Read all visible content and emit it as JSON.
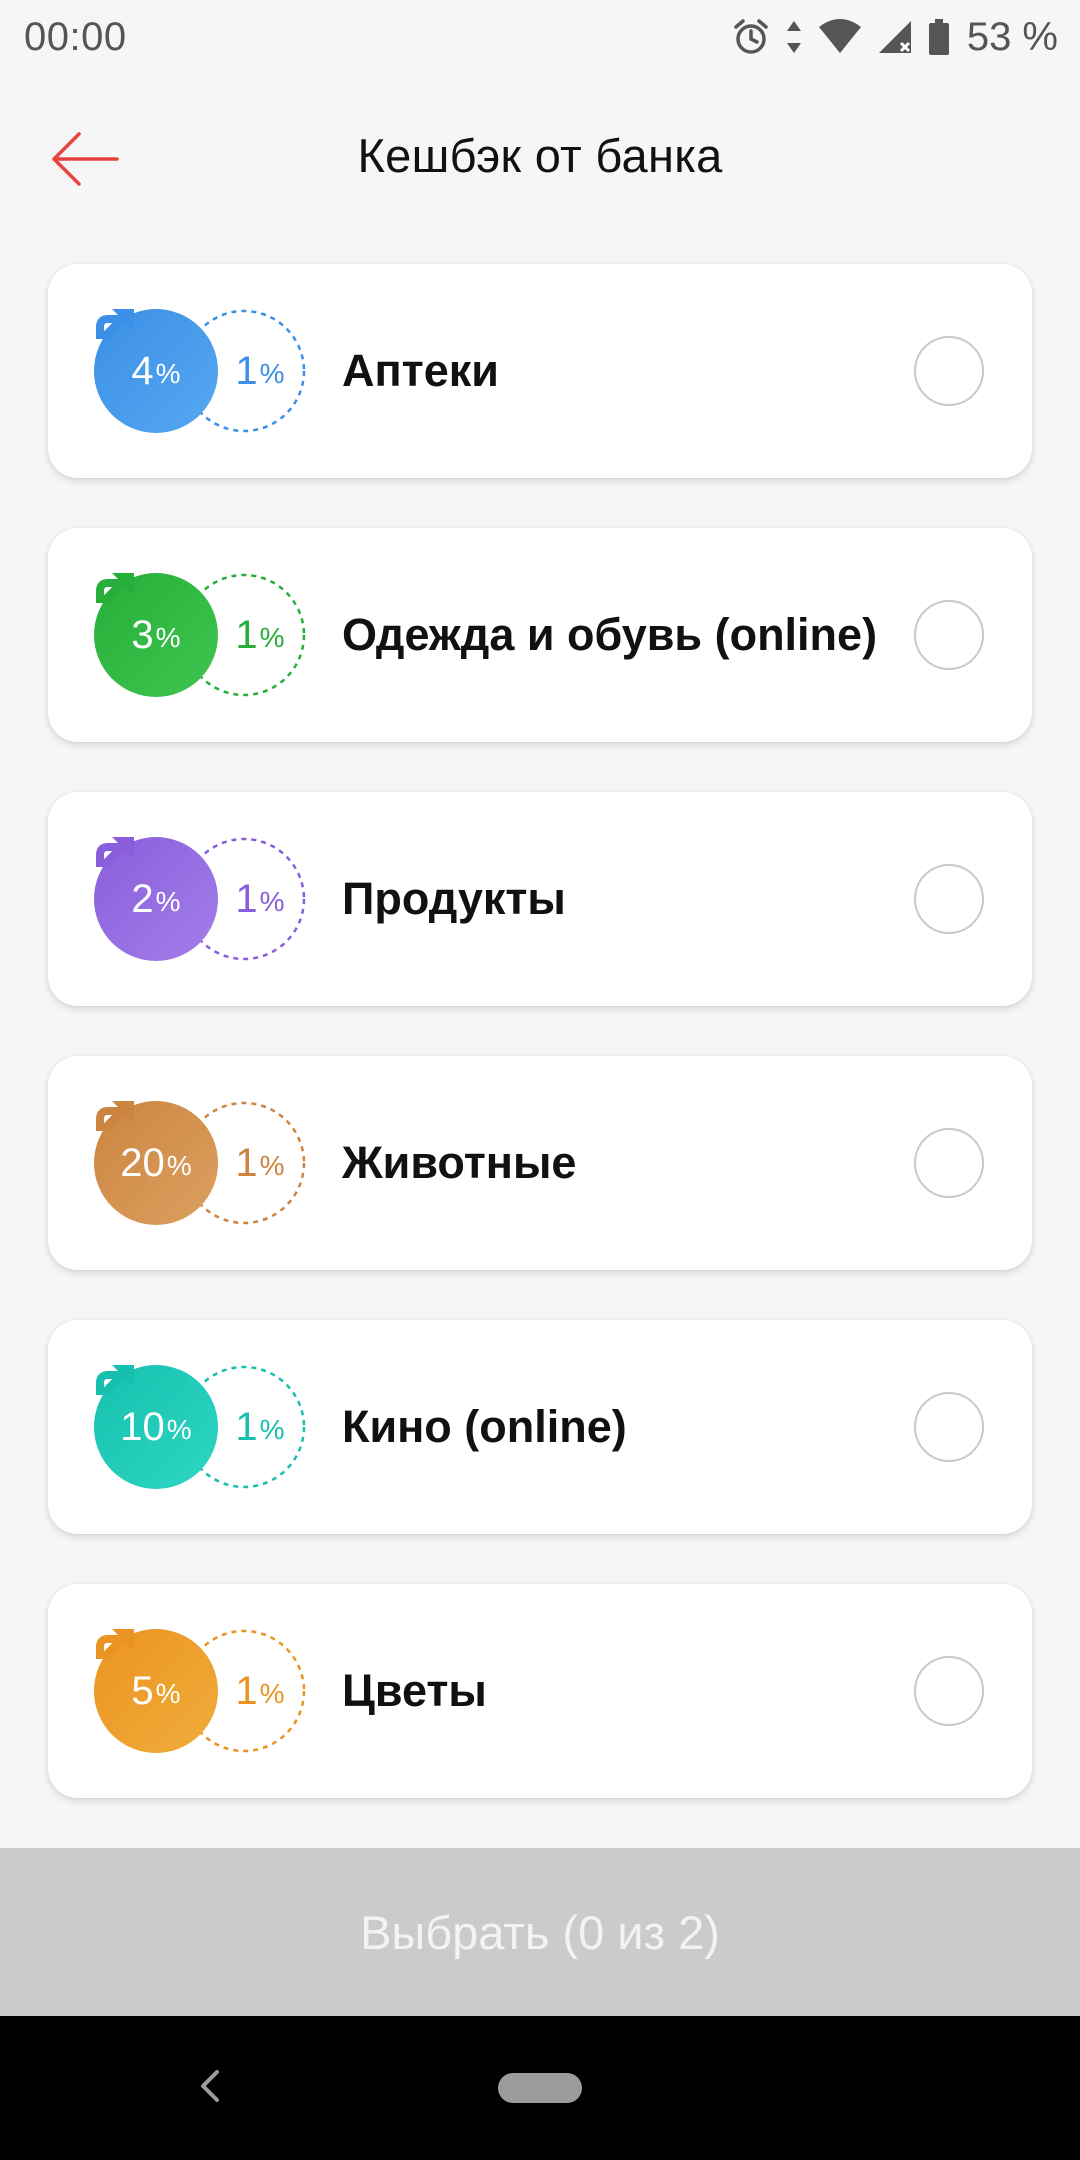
{
  "status_bar": {
    "time": "00:00",
    "battery": "53 %",
    "icons": [
      "alarm-icon",
      "data-arrows-icon",
      "wifi-icon",
      "signal-icon",
      "battery-icon"
    ]
  },
  "header": {
    "title": "Кешбэк от банка",
    "back_icon": "arrow-left-icon"
  },
  "categories": [
    {
      "label": "Аптеки",
      "rate": "4",
      "base_rate": "1",
      "percent_sign": "%",
      "color": "#3b8fe6",
      "color_light": "#56a8f0"
    },
    {
      "label": "Одежда и обувь (online)",
      "rate": "3",
      "base_rate": "1",
      "percent_sign": "%",
      "color": "#27ae3a",
      "color_light": "#3fc650"
    },
    {
      "label": "Продукты",
      "rate": "2",
      "base_rate": "1",
      "percent_sign": "%",
      "color": "#8a5ddc",
      "color_light": "#a27fe8"
    },
    {
      "label": "Животные",
      "rate": "20",
      "base_rate": "1",
      "percent_sign": "%",
      "color": "#cc8440",
      "color_light": "#dca060"
    },
    {
      "label": "Кино (online)",
      "rate": "10",
      "base_rate": "1",
      "percent_sign": "%",
      "color": "#17bfae",
      "color_light": "#2ed6c4"
    },
    {
      "label": "Цветы",
      "rate": "5",
      "base_rate": "1",
      "percent_sign": "%",
      "color": "#eb9322",
      "color_light": "#f0ad3a"
    }
  ],
  "action": {
    "choose_label": "Выбрать (0 из 2)"
  },
  "nav": {
    "back_icon": "nav-back-icon",
    "home_icon": "nav-home-pill"
  }
}
